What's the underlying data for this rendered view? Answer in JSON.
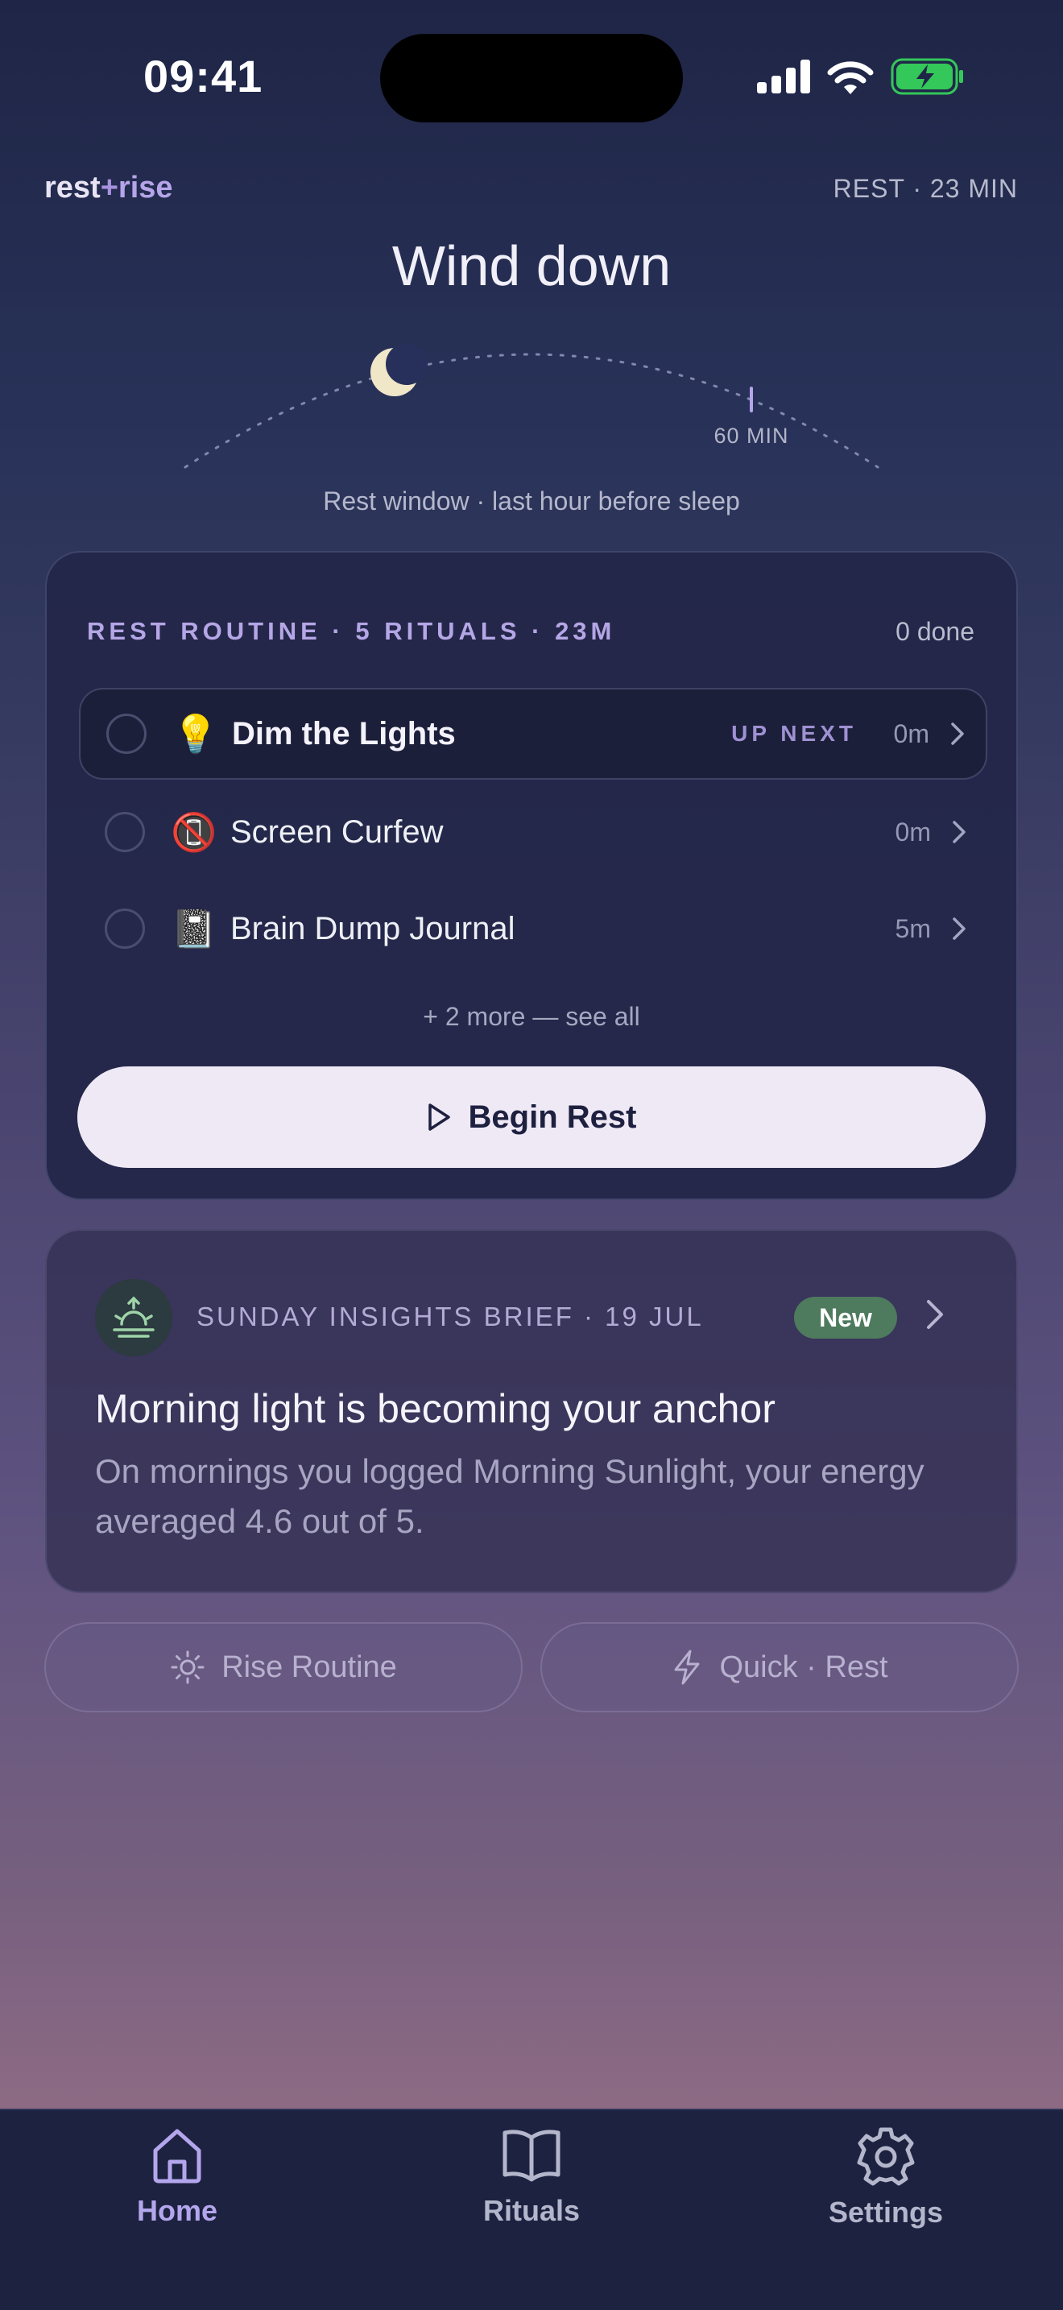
{
  "status_bar": {
    "time": "09:41"
  },
  "header": {
    "brand_rest": "rest",
    "brand_plus": "+",
    "brand_rise": "rise",
    "session_meta": "REST · 23 MIN",
    "title": "Wind down"
  },
  "arc": {
    "marker_label": "60 MIN",
    "caption": "Rest window · last hour before sleep"
  },
  "routine": {
    "heading": "REST ROUTINE · 5 RITUALS · 23M",
    "done_count": "0 done",
    "items": [
      {
        "emoji": "💡",
        "label": "Dim the Lights",
        "badge": "UP NEXT",
        "duration": "0m"
      },
      {
        "emoji": "📵",
        "label": "Screen Curfew",
        "badge": "",
        "duration": "0m"
      },
      {
        "emoji": "📓",
        "label": "Brain Dump Journal",
        "badge": "",
        "duration": "5m"
      }
    ],
    "more_link": "+ 2 more — see all",
    "begin_label": "Begin Rest"
  },
  "insight": {
    "kicker": "SUNDAY INSIGHTS BRIEF · 19 JUL",
    "badge": "New",
    "title": "Morning light is becoming your anchor",
    "body": "On mornings you logged Morning Sunlight, your energy averaged 4.6 out of 5."
  },
  "actions": {
    "rise_label": "Rise Routine",
    "quick_label": "Quick · Rest"
  },
  "tabs": [
    {
      "label": "Home",
      "icon": "home-icon",
      "active": true
    },
    {
      "label": "Rituals",
      "icon": "book-icon",
      "active": false
    },
    {
      "label": "Settings",
      "icon": "gear-icon",
      "active": false
    }
  ],
  "colors": {
    "accent": "#b4a6ec",
    "new_badge": "#4e7a5e",
    "battery": "#34c759",
    "moon": "#f0e6c8"
  }
}
